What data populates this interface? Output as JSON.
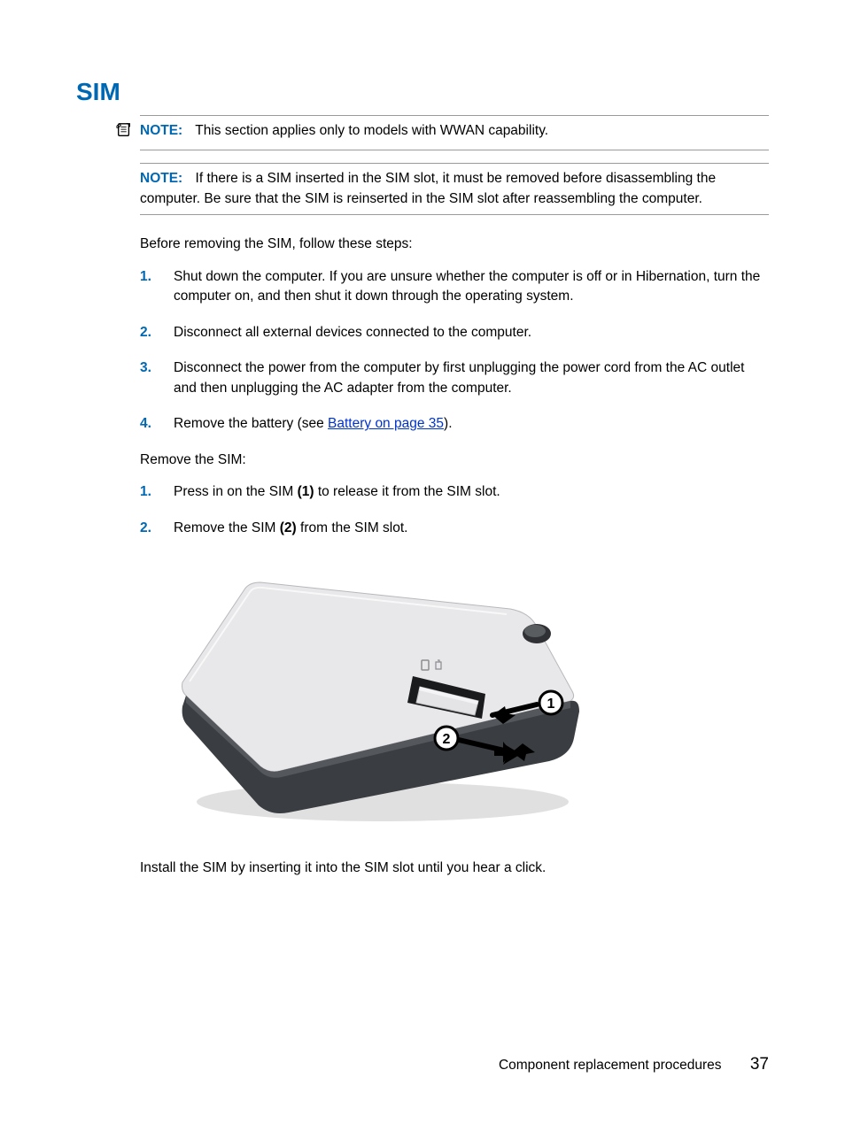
{
  "heading": "SIM",
  "note1": {
    "label": "NOTE:",
    "text": "This section applies only to models with WWAN capability."
  },
  "note2": {
    "label": "NOTE:",
    "text": "If there is a SIM inserted in the SIM slot, it must be removed before disassembling the computer. Be sure that the SIM is reinserted in the SIM slot after reassembling the computer."
  },
  "intro1": "Before removing the SIM, follow these steps:",
  "steps1": {
    "s1": "Shut down the computer. If you are unsure whether the computer is off or in Hibernation, turn the computer on, and then shut it down through the operating system.",
    "s2": "Disconnect all external devices connected to the computer.",
    "s3": "Disconnect the power from the computer by first unplugging the power cord from the AC outlet and then unplugging the AC adapter from the computer.",
    "s4_a": "Remove the battery (see ",
    "s4_link": "Battery on page 35",
    "s4_b": ")."
  },
  "intro2": "Remove the SIM:",
  "steps2": {
    "s1_a": "Press in on the SIM ",
    "s1_bold": "(1)",
    "s1_b": " to release it from the SIM slot.",
    "s2_a": "Remove the SIM ",
    "s2_bold": "(2)",
    "s2_b": " from the SIM slot."
  },
  "closing": "Install the SIM by inserting it into the SIM slot until you hear a click.",
  "footer": {
    "section": "Component replacement procedures",
    "page": "37"
  },
  "callouts": {
    "c1": "1",
    "c2": "2"
  }
}
